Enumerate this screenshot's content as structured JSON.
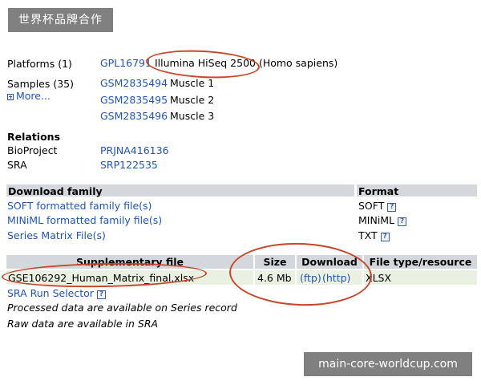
{
  "watermarks": {
    "top": "世界杯品牌合作",
    "bottom": "main-core-worldcup.com"
  },
  "platforms": {
    "label": "Platforms (1)",
    "id": "GPL16791",
    "description": "Illumina HiSeq 2500 (Homo sapiens)"
  },
  "samples": {
    "label": "Samples (35)",
    "more_label": "More...",
    "items": [
      {
        "id": "GSM2835494",
        "name": "Muscle 1"
      },
      {
        "id": "GSM2835495",
        "name": "Muscle 2"
      },
      {
        "id": "GSM2835496",
        "name": "Muscle 3"
      }
    ]
  },
  "relations": {
    "heading": "Relations",
    "bioproject_label": "BioProject",
    "bioproject_id": "PRJNA416136",
    "sra_label": "SRA",
    "sra_id": "SRP122535"
  },
  "download_family": {
    "header": "Download family",
    "format_header": "Format",
    "rows": [
      {
        "label": "SOFT formatted family file(s)",
        "format": "SOFT"
      },
      {
        "label": "MINiML formatted family file(s)",
        "format": "MINiML"
      },
      {
        "label": "Series Matrix File(s)",
        "format": "TXT"
      }
    ]
  },
  "supplementary": {
    "headers": {
      "file": "Supplementary file",
      "size": "Size",
      "download": "Download",
      "type": "File type/resource"
    },
    "row": {
      "file": "GSE106292_Human_Matrix_final.xlsx",
      "size": "4.6 Mb",
      "ftp": "(ftp)",
      "http": "(http)",
      "type": "XLSX"
    },
    "sra_run_selector": "SRA Run Selector",
    "notes": [
      "Processed data are available on Series record",
      "Raw data are available in SRA"
    ]
  },
  "help_icon_glyph": "?",
  "colors": {
    "link": "#2255aa",
    "header_bg": "#d4d8dc",
    "row_bg": "#eaf0e2",
    "annotation": "#c8452a",
    "watermark_bg": "#808080"
  }
}
